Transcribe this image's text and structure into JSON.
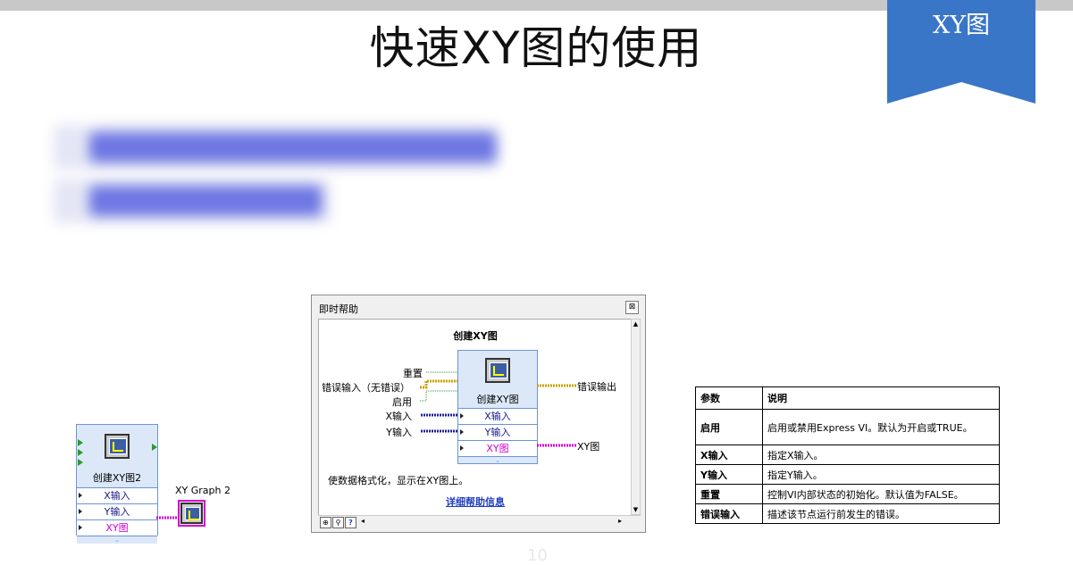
{
  "slide": {
    "title": "快速XY图的使用",
    "ribbon_label": "XY图",
    "page_number": "10",
    "accent_color": "#3a76c8"
  },
  "snippet": {
    "node_title": "创建XY图2",
    "rows": [
      "X输入",
      "Y输入",
      "XY图"
    ],
    "graph_label": "XY Graph 2"
  },
  "help_window": {
    "window_title": "即时帮助",
    "heading": "创建XY图",
    "node_title": "创建XY图",
    "left_terminals": [
      "重置",
      "错误输入（无错误）",
      "启用",
      "X输入",
      "Y输入"
    ],
    "rows": [
      "X输入",
      "Y输入",
      "XY图"
    ],
    "right_terminals": [
      "错误输出",
      "XY图"
    ],
    "description": "使数据格式化，显示在XY图上。",
    "link": "详细帮助信息",
    "toolbar_icons": [
      "lock-icon",
      "pin-icon",
      "question-icon"
    ]
  },
  "param_table": {
    "headers": [
      "参数",
      "说明"
    ],
    "rows": [
      {
        "name": "启用",
        "desc": "启用或禁用Express VI。默认为开启或TRUE。"
      },
      {
        "name": "X输入",
        "desc": "指定X输入。"
      },
      {
        "name": "Y输入",
        "desc": "指定Y输入。"
      },
      {
        "name": "重置",
        "desc": "控制VI内部状态的初始化。默认值为FALSE。"
      },
      {
        "name": "错误输入",
        "desc": "描述该节点运行前发生的错误。"
      }
    ]
  }
}
